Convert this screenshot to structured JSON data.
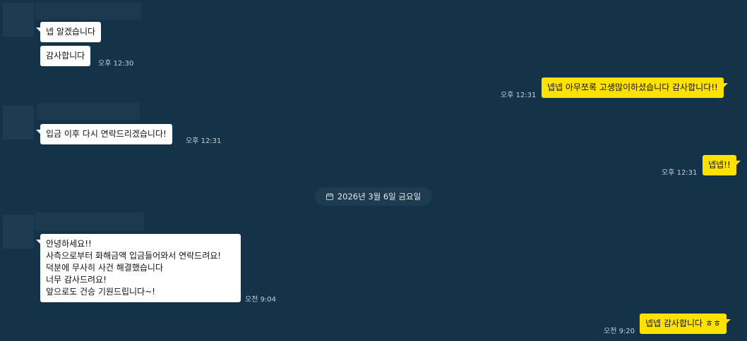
{
  "messages": [
    {
      "id": "m1",
      "from": "other",
      "text": "넵 알겠습니다"
    },
    {
      "id": "m2",
      "from": "other",
      "text": "감사합니다",
      "time": "오후 12:30"
    },
    {
      "id": "m3",
      "from": "me",
      "text": "넵넵 아무쪼록 고생많이하셨습니다 감사합니다!!",
      "time": "오후 12:31"
    },
    {
      "id": "m4",
      "from": "other",
      "text": "입금 이후 다시 연락드리겠습니다!",
      "time": "오후 12:31"
    },
    {
      "id": "m5",
      "from": "me",
      "text": "넵넵!!",
      "time": "오후 12:31"
    },
    {
      "id": "m6",
      "from": "other",
      "lines": [
        "안녕하세요!!",
        "사측으로부터 화해금액 입금들어와서 연락드려요!",
        "덕분에 무사히 사건 해결했습니다",
        "너무 감사드려요!",
        "앞으로도 건승 기원드립니다~!"
      ],
      "time": "오전 9:04"
    },
    {
      "id": "m7",
      "from": "me",
      "text": "넵넵 감사합니다 ㅎㅎ",
      "time": "오전 9:20"
    }
  ],
  "date_divider": {
    "label": "2026년 3월 6일 금요일",
    "icon": "calendar-icon"
  },
  "colors": {
    "background": "#143349",
    "incoming_bubble": "#ffffff",
    "outgoing_bubble": "#fde200",
    "redacted_block": "#1d3c52"
  }
}
